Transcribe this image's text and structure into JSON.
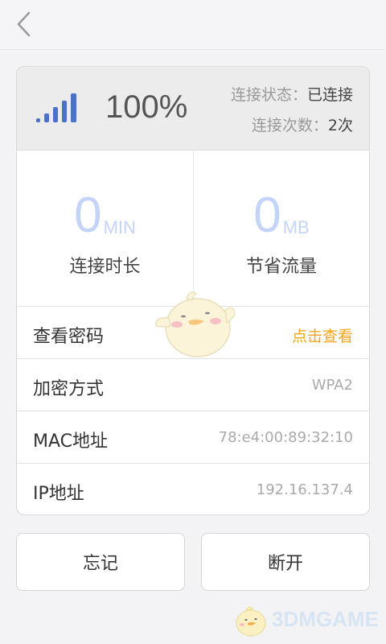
{
  "header": {
    "back_icon": "chevron-left-icon"
  },
  "signal": {
    "icon": "signal-bars-icon",
    "value": "100%"
  },
  "status": {
    "state_label": "连接状态：",
    "state_value": "已连接",
    "count_label": "连接次数：",
    "count_value": "2次"
  },
  "stats": {
    "duration": {
      "value": "0",
      "unit": "MIN",
      "label": "连接时长"
    },
    "traffic": {
      "value": "0",
      "unit": "MB",
      "label": "节省流量"
    }
  },
  "rows": [
    {
      "label": "查看密码",
      "value": "点击查看"
    },
    {
      "label": "加密方式",
      "value": "WPA2"
    },
    {
      "label": "MAC地址",
      "value": "78:e4:00:89:32:10"
    },
    {
      "label": "IP地址",
      "value": "192.16.137.4"
    }
  ],
  "buttons": {
    "forget": "忘记",
    "disconnect": "断开"
  },
  "watermark": {
    "text": "3DMGAME"
  },
  "colors": {
    "accent_link": "#f3a51c",
    "signal_blue": "#4a72c8",
    "stat_number": "#c4d4f8"
  }
}
